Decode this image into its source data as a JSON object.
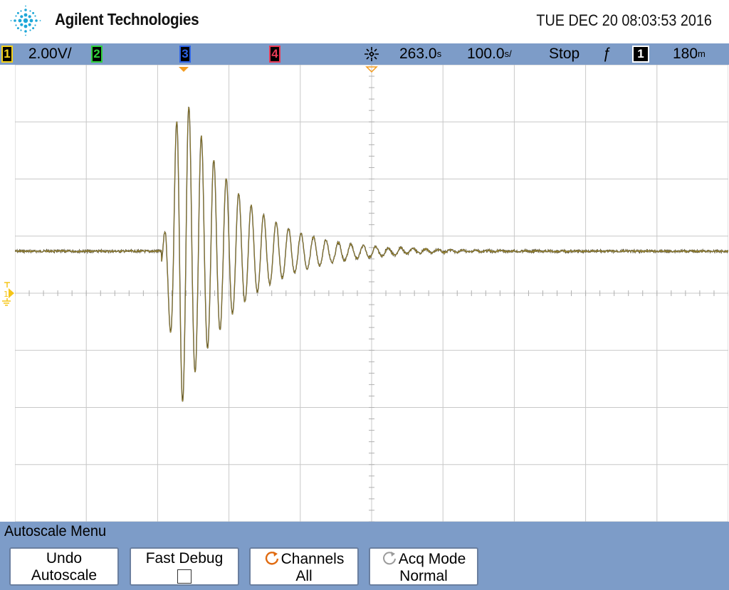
{
  "header": {
    "brand": "Agilent Technologies",
    "datetime": "TUE DEC 20 08:03:53 2016"
  },
  "status_bar": {
    "ch1_label": "1",
    "ch1_scale": "2.00V/",
    "ch2_label": "2",
    "ch3_label": "3",
    "ch4_label": "4",
    "time_delay_value": "263.0",
    "time_delay_unit": "s",
    "time_scale_value": "100.0",
    "time_scale_unit": "s/",
    "run_state": "Stop",
    "trigger_slope": "ƒ",
    "trigger_source": "1",
    "trigger_level_value": "180",
    "trigger_level_unit": "m"
  },
  "plot": {
    "ground_marker": "1",
    "trace_color": "#3a3520",
    "grid_color": "#c8c8c8"
  },
  "menu": {
    "title": "Autoscale Menu",
    "softkeys": [
      {
        "line1": "Undo",
        "line2": "Autoscale"
      },
      {
        "line1": "Fast Debug",
        "line2": ""
      },
      {
        "line1": "Channels",
        "line2": "All"
      },
      {
        "line1": "Acq Mode",
        "line2": "Normal"
      }
    ]
  },
  "colors": {
    "status_bar_bg": "#7d9cc8",
    "channel1": "#f5d21b",
    "channel2": "#2fd13b",
    "channel3": "#2d63e6",
    "channel4": "#e83a55",
    "trigger_marker": "#f39c1f"
  }
}
